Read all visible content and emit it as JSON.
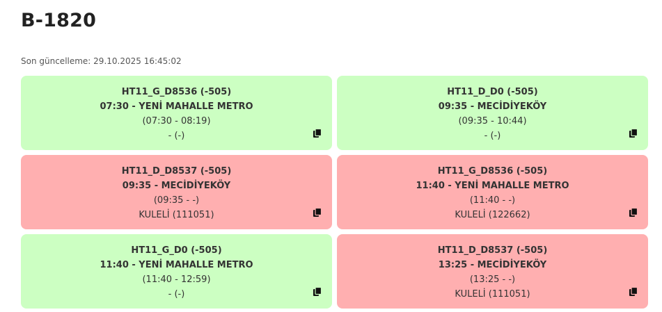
{
  "page": {
    "title": "B-1820",
    "last_updated": "Son güncelleme: 29.10.2025 16:45:02"
  },
  "cards": [
    {
      "status": "green",
      "line1": "HT11_G_D8536 (-505)",
      "line2": "07:30 - YENİ MAHALLE METRO",
      "line3": "(07:30 - 08:19)",
      "line4": "- (-)",
      "icon": "copy-icon"
    },
    {
      "status": "green",
      "line1": "HT11_D_D0 (-505)",
      "line2": "09:35 - MECİDİYEKÖY",
      "line3": "(09:35 - 10:44)",
      "line4": "- (-)",
      "icon": "copy-icon"
    },
    {
      "status": "red",
      "line1": "HT11_D_D8537 (-505)",
      "line2": "09:35 - MECİDİYEKÖY",
      "line3": "(09:35 - -)",
      "line4": "KULELİ (111051)",
      "icon": "copy-icon"
    },
    {
      "status": "red",
      "line1": "HT11_G_D8536 (-505)",
      "line2": "11:40 - YENİ MAHALLE METRO",
      "line3": "(11:40 - -)",
      "line4": "KULELİ (122662)",
      "icon": "copy-icon"
    },
    {
      "status": "green",
      "line1": "HT11_G_D0 (-505)",
      "line2": "11:40 - YENİ MAHALLE METRO",
      "line3": "(11:40 - 12:59)",
      "line4": "- (-)",
      "icon": "copy-icon"
    },
    {
      "status": "red",
      "line1": "HT11_D_D8537 (-505)",
      "line2": "13:25 - MECİDİYEKÖY",
      "line3": "(13:25 - -)",
      "line4": "KULELİ (111051)",
      "icon": "copy-icon"
    }
  ],
  "colors": {
    "green": "#ccffc2",
    "red": "#ffafb0"
  }
}
